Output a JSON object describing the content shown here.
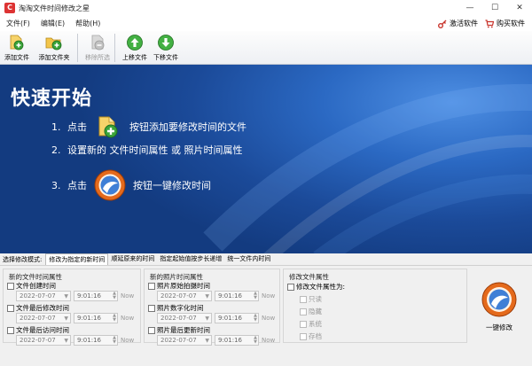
{
  "window": {
    "title": "淘淘文件时间修改之星",
    "minimize": "—",
    "maximize": "☐",
    "close": "✕"
  },
  "menu": {
    "items": [
      "文件(F)",
      "编辑(E)",
      "帮助(H)"
    ],
    "activate_label": "激活软件",
    "buy_label": "购买软件"
  },
  "toolbar": {
    "add_file": "添加文件",
    "add_folder": "添加文件夹",
    "remove_selected": "移除所选",
    "move_up": "上移文件",
    "move_down": "下移文件"
  },
  "guide": {
    "title": "快速开始",
    "step1_num": "1.",
    "step1_pre": "点击",
    "step1_post": "按钮添加要修改时间的文件",
    "step2_num": "2.",
    "step2_text": "设置新的 文件时间属性 或 照片时间属性",
    "step3_num": "3.",
    "step3_pre": "点击",
    "step3_post": "按钮一键修改时间"
  },
  "tabs": {
    "label": "选择修改模式:",
    "items": [
      "修改为指定的新时间",
      "顺延原来的时间",
      "指定起始值按步长递增",
      "统一文件内时间"
    ],
    "active_index": 0
  },
  "file_time": {
    "title": "新的文件时间属性",
    "created_label": "文件创建时间",
    "modified_label": "文件最后修改时间",
    "accessed_label": "文件最后访问时间",
    "date": "2022-07-07",
    "time": "9:01:16",
    "now": "Now"
  },
  "photo_time": {
    "title": "新的照片时间属性",
    "taken_label": "照片原始拍摄时间",
    "digitized_label": "照片数字化时间",
    "updated_label": "照片最后更新时间",
    "date": "2022-07-07",
    "time": "9:01:16",
    "now": "Now"
  },
  "attributes": {
    "title": "修改文件属性",
    "toggle_label": "修改文件属性为:",
    "readonly": "只读",
    "hidden": "隐藏",
    "system": "系统",
    "archive": "存档"
  },
  "action": {
    "one_click_label": "一键修改"
  },
  "colors": {
    "guide_bg": "#1b4a99",
    "guide_accent": "#4e8fe3"
  }
}
